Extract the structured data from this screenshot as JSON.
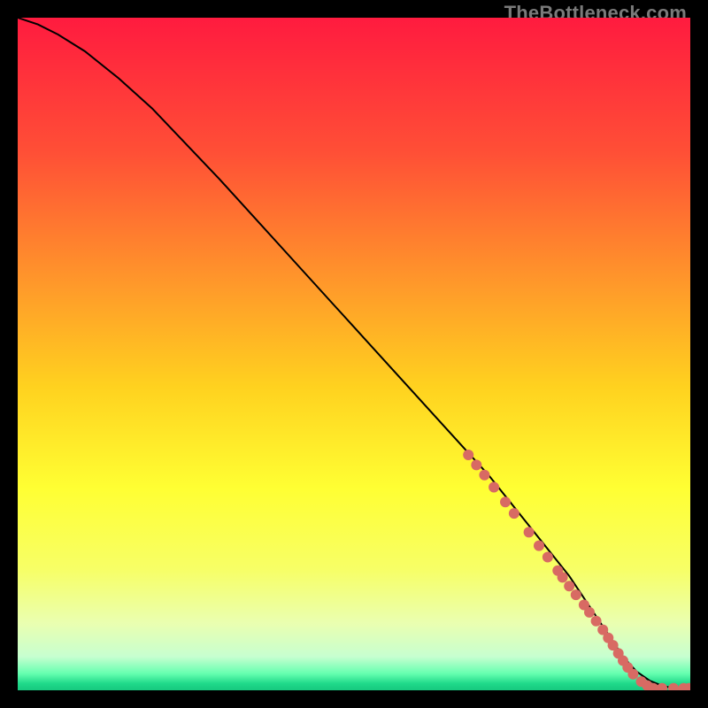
{
  "watermark": "TheBottleneck.com",
  "chart_data": {
    "type": "line",
    "title": "",
    "xlabel": "",
    "ylabel": "",
    "xlim": [
      0,
      100
    ],
    "ylim": [
      0,
      100
    ],
    "grid": false,
    "legend": false,
    "background_gradient": {
      "stops": [
        {
          "offset": 0.0,
          "color": "#ff1b3f"
        },
        {
          "offset": 0.2,
          "color": "#ff4f36"
        },
        {
          "offset": 0.4,
          "color": "#ff9a2a"
        },
        {
          "offset": 0.55,
          "color": "#ffd21f"
        },
        {
          "offset": 0.7,
          "color": "#ffff33"
        },
        {
          "offset": 0.82,
          "color": "#f7ff66"
        },
        {
          "offset": 0.9,
          "color": "#eaffb0"
        },
        {
          "offset": 0.95,
          "color": "#c7ffd0"
        },
        {
          "offset": 0.975,
          "color": "#66ffb0"
        },
        {
          "offset": 0.99,
          "color": "#1fd98a"
        },
        {
          "offset": 1.0,
          "color": "#17c97f"
        }
      ]
    },
    "series": [
      {
        "name": "curve",
        "color": "#000000",
        "x": [
          0,
          3,
          6,
          10,
          15,
          20,
          30,
          40,
          50,
          60,
          70,
          78,
          82,
          85,
          88,
          90,
          92,
          94,
          96,
          98,
          100
        ],
        "y": [
          100,
          99,
          97.5,
          95,
          91,
          86.5,
          76,
          65,
          54,
          43,
          32,
          22,
          17,
          12.5,
          8,
          5,
          2.8,
          1.4,
          0.6,
          0.3,
          0.3
        ]
      }
    ],
    "scatter": {
      "name": "points",
      "color": "#d86a63",
      "radius": 6,
      "points": [
        {
          "x": 67,
          "y": 35
        },
        {
          "x": 68.2,
          "y": 33.5
        },
        {
          "x": 69.4,
          "y": 32
        },
        {
          "x": 70.8,
          "y": 30.2
        },
        {
          "x": 72.5,
          "y": 28
        },
        {
          "x": 73.8,
          "y": 26.3
        },
        {
          "x": 76,
          "y": 23.5
        },
        {
          "x": 77.5,
          "y": 21.5
        },
        {
          "x": 78.8,
          "y": 19.8
        },
        {
          "x": 80.3,
          "y": 17.8
        },
        {
          "x": 81,
          "y": 16.8
        },
        {
          "x": 82,
          "y": 15.5
        },
        {
          "x": 83,
          "y": 14.2
        },
        {
          "x": 84.2,
          "y": 12.7
        },
        {
          "x": 85,
          "y": 11.6
        },
        {
          "x": 86,
          "y": 10.3
        },
        {
          "x": 87,
          "y": 9
        },
        {
          "x": 87.8,
          "y": 7.8
        },
        {
          "x": 88.5,
          "y": 6.7
        },
        {
          "x": 89.3,
          "y": 5.5
        },
        {
          "x": 90,
          "y": 4.4
        },
        {
          "x": 90.7,
          "y": 3.4
        },
        {
          "x": 91.5,
          "y": 2.4
        },
        {
          "x": 92.7,
          "y": 1.3
        },
        {
          "x": 93.6,
          "y": 0.7
        },
        {
          "x": 94.5,
          "y": 0.3
        },
        {
          "x": 95.8,
          "y": 0.3
        },
        {
          "x": 97.5,
          "y": 0.3
        },
        {
          "x": 99,
          "y": 0.3
        },
        {
          "x": 99.8,
          "y": 0.3
        }
      ]
    }
  }
}
